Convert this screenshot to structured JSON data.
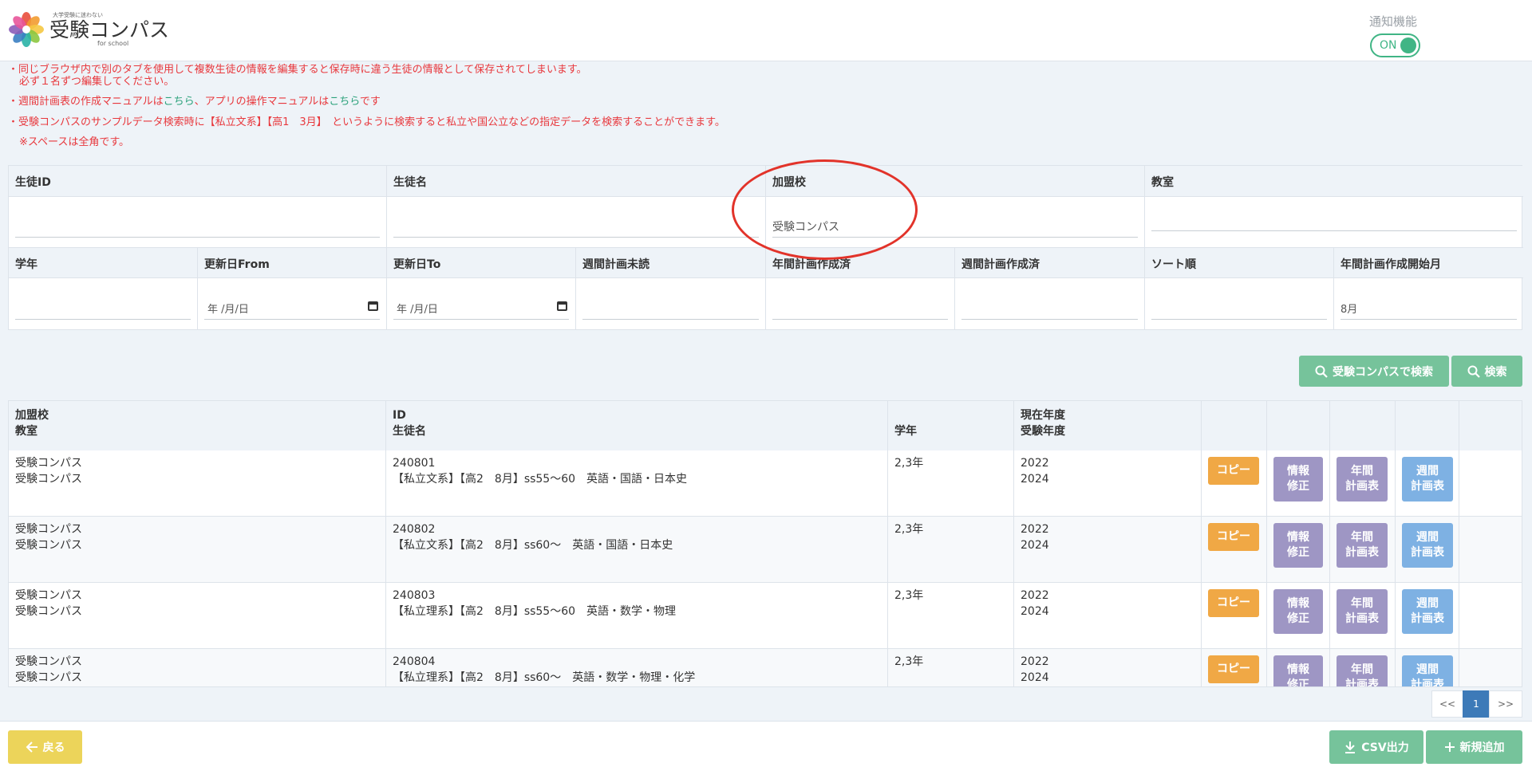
{
  "header": {
    "logo_tagline": "大学受験に迷わない",
    "logo_name": "受験コンパス",
    "logo_sub": "for school",
    "notify_label": "通知機能",
    "notify_state": "ON"
  },
  "notices": {
    "line1": "・同じブラウザ内で別のタブを使用して複数生徒の情報を編集すると保存時に違う生徒の情報として保存されてしまいます。",
    "line1b": "必ず１名ずつ編集してください。",
    "line2_a": "・週間計画表の作成マニュアルは",
    "line2_link1": "こちら",
    "line2_b": "、アプリの操作マニュアルは",
    "line2_link2": "こちら",
    "line2_c": "です",
    "line3": "・受験コンパスのサンプルデータ検索時に【私立文系】【高1　3月】　というように検索すると私立や国公立などの指定データを検索することができます。",
    "line3b": "※スペースは全角です。"
  },
  "search": {
    "row1_labels": [
      "生徒ID",
      "生徒名",
      "加盟校",
      "教室"
    ],
    "row1_values": [
      "",
      "",
      "受験コンパス",
      ""
    ],
    "row2_labels": [
      "学年",
      "更新日From",
      "更新日To",
      "週間計画未読",
      "年間計画作成済",
      "週間計画作成済",
      "ソート順",
      "年間計画作成開始月"
    ],
    "date_placeholder": "年 /月/日",
    "start_month": "8月",
    "compass_search_label": "受験コンパスで検索",
    "search_label": "検索"
  },
  "table": {
    "headers": {
      "col1_line1": "加盟校",
      "col1_line2": "教室",
      "col2_line1": "ID",
      "col2_line2": "生徒名",
      "col3": "学年",
      "col4_line1": "現在年度",
      "col4_line2": "受験年度"
    },
    "rows": [
      {
        "school": "受験コンパス",
        "classroom": "受験コンパス",
        "id": "240801",
        "name": "【私立文系】【高2　8月】ss55～60　英語・国語・日本史",
        "grade": "2,3年",
        "year": "2022",
        "exam_year": "2024"
      },
      {
        "school": "受験コンパス",
        "classroom": "受験コンパス",
        "id": "240802",
        "name": "【私立文系】【高2　8月】ss60～　英語・国語・日本史",
        "grade": "2,3年",
        "year": "2022",
        "exam_year": "2024"
      },
      {
        "school": "受験コンパス",
        "classroom": "受験コンパス",
        "id": "240803",
        "name": "【私立理系】【高2　8月】ss55～60　英語・数学・物理",
        "grade": "2,3年",
        "year": "2022",
        "exam_year": "2024"
      },
      {
        "school": "受験コンパス",
        "classroom": "受験コンパス",
        "id": "240804",
        "name": "【私立理系】【高2　8月】ss60～　英語・数学・物理・化学",
        "grade": "2,3年",
        "year": "2022",
        "exam_year": "2024"
      }
    ],
    "actions": {
      "copy": "コピー",
      "info_1": "情報",
      "info_2": "修正",
      "annual_1": "年間",
      "annual_2": "計画表",
      "weekly_1": "週間",
      "weekly_2": "計画表"
    }
  },
  "pagination": {
    "prev": "<<",
    "current": "1",
    "next": ">>"
  },
  "footer": {
    "back_label": "戻る",
    "csv_label": "CSV出力",
    "new_label": "新規追加"
  },
  "colors": {
    "notice_red": "#e8383d",
    "link_green": "#2aa17a",
    "primary_green": "#76c39b",
    "copy_orange": "#f0a845",
    "purple": "#9e96c4",
    "blue": "#7eb1e3",
    "back_yellow": "#ecd45a",
    "annotation_red": "#e2332a"
  }
}
